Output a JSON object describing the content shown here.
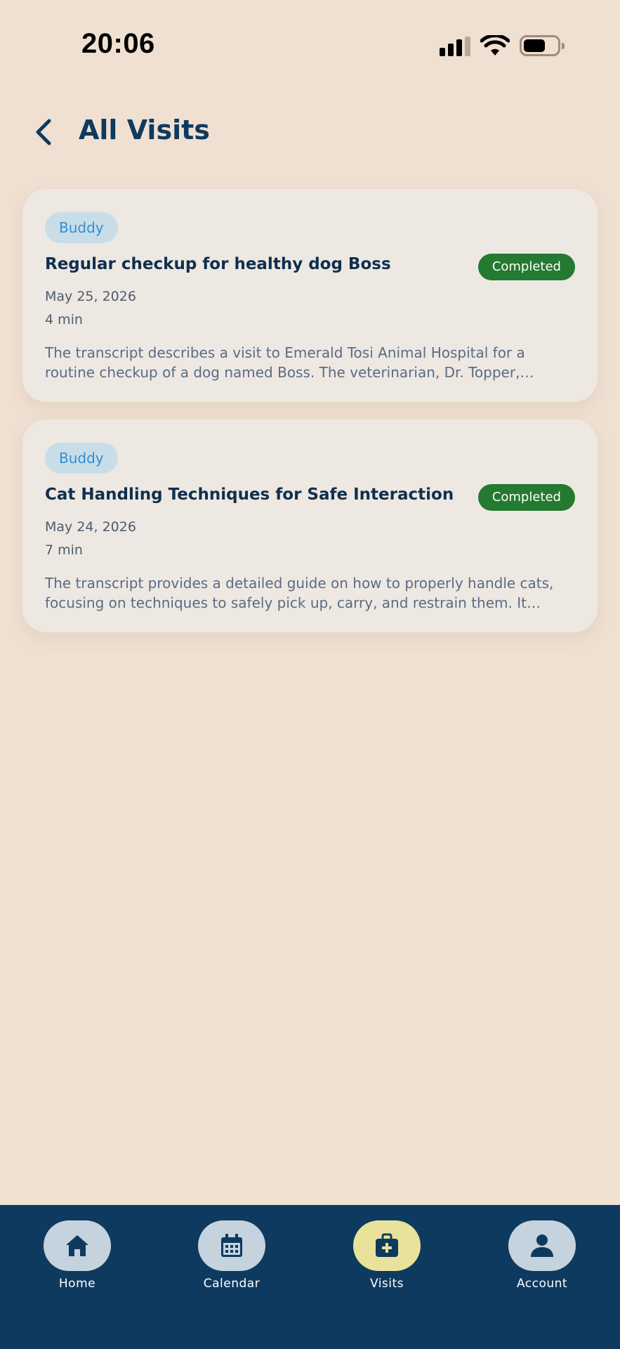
{
  "status_bar": {
    "time": "20:06"
  },
  "header": {
    "title": "All Visits"
  },
  "visits": [
    {
      "pet": "Buddy",
      "title": "Regular checkup for healthy dog Boss",
      "status": "Completed",
      "date": "May 25, 2026",
      "duration": "4 min",
      "summary": "The transcript describes a visit to Emerald Tosi Animal Hospital for a routine checkup of a dog named Boss. The veterinarian, Dr. Topper, conducted a thorough examination."
    },
    {
      "pet": "Buddy",
      "title": "Cat Handling Techniques for Safe Interaction",
      "status": "Completed",
      "date": "May 24, 2026",
      "duration": "7 min",
      "summary": "The transcript provides a detailed guide on how to properly handle cats, focusing on techniques to safely pick up, carry, and restrain them. It includes tips for reducing stress."
    }
  ],
  "nav": {
    "items": [
      {
        "label": "Home",
        "icon": "home-icon"
      },
      {
        "label": "Calendar",
        "icon": "calendar-icon"
      },
      {
        "label": "Visits",
        "icon": "medical-bag-icon",
        "active": true
      },
      {
        "label": "Account",
        "icon": "account-icon"
      }
    ]
  },
  "colors": {
    "background": "#f0e0d2",
    "primary": "#0f3a5f",
    "completed": "#237a30",
    "active_nav": "#e8e29a"
  }
}
